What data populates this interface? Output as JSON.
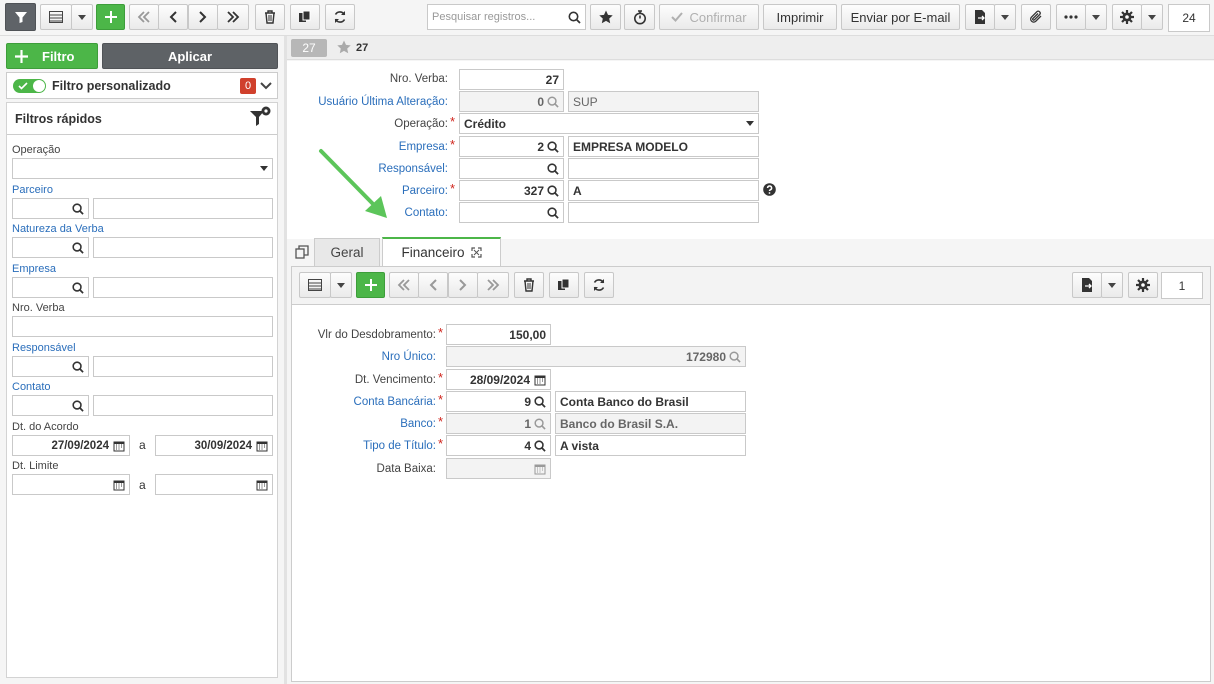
{
  "toolbar": {
    "search_placeholder": "Pesquisar registros...",
    "confirm_label": "Confirmar",
    "print_label": "Imprimir",
    "email_label": "Enviar por E-mail",
    "page_size": "24"
  },
  "sidebar": {
    "filter_button": "Filtro",
    "apply_button": "Aplicar",
    "custom_filter_label": "Filtro personalizado",
    "custom_filter_count": "0",
    "quick_filters_title": "Filtros rápidos",
    "fields": {
      "operacao": "Operação",
      "parceiro": "Parceiro",
      "natureza": "Natureza da Verba",
      "empresa": "Empresa",
      "nro_verba": "Nro. Verba",
      "responsavel": "Responsável",
      "contato": "Contato",
      "dt_acordo": "Dt. do Acordo",
      "dt_acordo_from": "27/09/2024",
      "dt_acordo_to": "30/09/2024",
      "dt_limite": "Dt. Limite",
      "a1": "a",
      "a2": "a"
    }
  },
  "record": {
    "badge": "27",
    "star_label": "27",
    "fields": {
      "nro_verba_label": "Nro. Verba:",
      "nro_verba": "27",
      "usuario_label": "Usuário Última Alteração:",
      "usuario_code": "0",
      "usuario_name": "SUP",
      "operacao_label": "Operação:",
      "operacao": "Crédito",
      "empresa_label": "Empresa:",
      "empresa_code": "2",
      "empresa_name": "EMPRESA MODELO",
      "responsavel_label": "Responsável:",
      "parceiro_label": "Parceiro:",
      "parceiro_code": "327",
      "parceiro_name": "A",
      "contato_label": "Contato:"
    }
  },
  "tabs": [
    {
      "label": "Geral"
    },
    {
      "label": "Financeiro"
    }
  ],
  "financeiro": {
    "page_number": "1",
    "vlr_label": "Vlr do Desdobramento:",
    "vlr": "150,00",
    "nro_unico_label": "Nro Único:",
    "nro_unico": "172980",
    "dt_venc_label": "Dt. Vencimento:",
    "dt_venc": "28/09/2024",
    "conta_label": "Conta Bancária:",
    "conta_code": "9",
    "conta_name": "Conta Banco do Brasil",
    "banco_label": "Banco:",
    "banco_code": "1",
    "banco_name": "Banco do Brasil S.A.",
    "tipo_label": "Tipo de Título:",
    "tipo_code": "4",
    "tipo_name": "A vista",
    "baixa_label": "Data Baixa:"
  },
  "colors": {
    "accent_green": "#4cb648",
    "link_blue": "#2a6ebb",
    "required_red": "#d0241c",
    "arrow_green": "#5cc55a"
  }
}
